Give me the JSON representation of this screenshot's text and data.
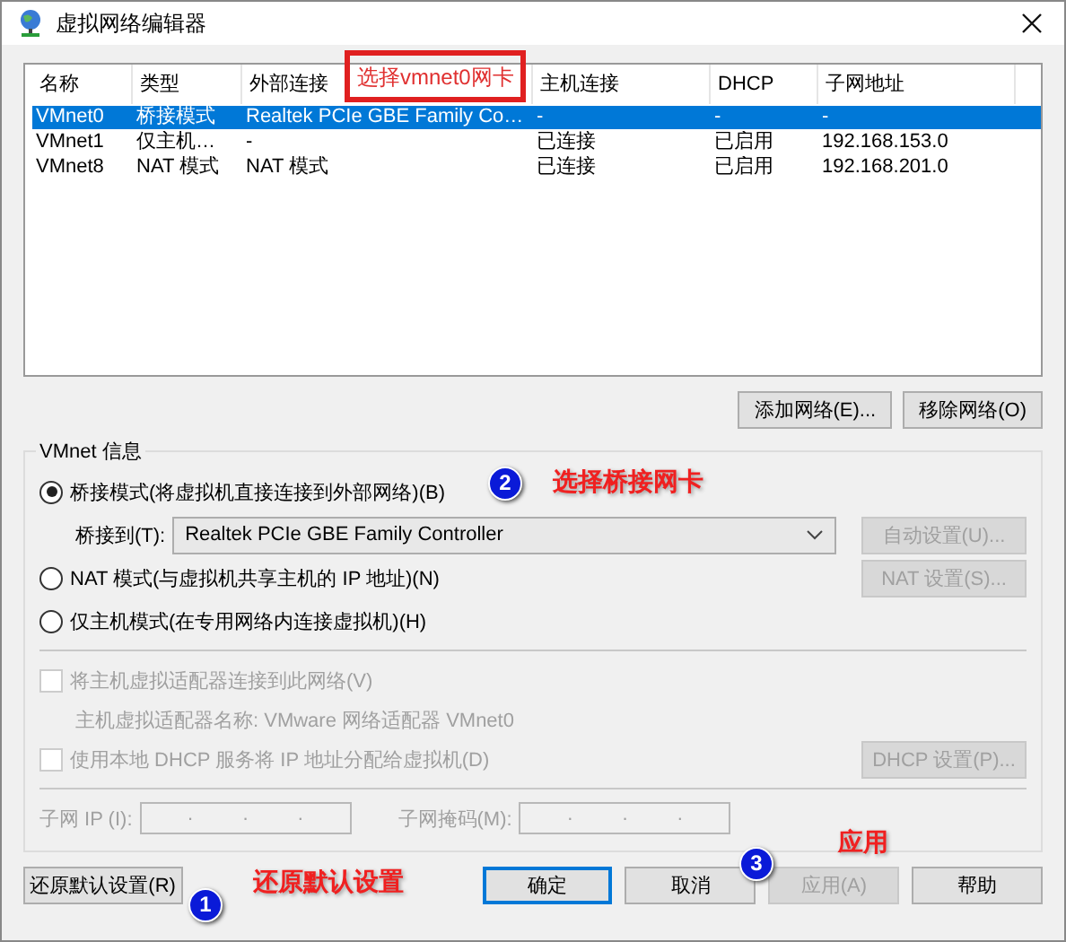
{
  "window": {
    "title": "虚拟网络编辑器"
  },
  "table": {
    "columns": [
      "名称",
      "类型",
      "外部连接",
      "主机连接",
      "DHCP",
      "子网地址"
    ],
    "rows": [
      {
        "cells": [
          "VMnet0",
          "桥接模式",
          "Realtek PCIe GBE Family Co…",
          "-",
          "-",
          "-"
        ],
        "selected": true
      },
      {
        "cells": [
          "VMnet1",
          "仅主机…",
          "-",
          "已连接",
          "已启用",
          "192.168.153.0"
        ],
        "selected": false
      },
      {
        "cells": [
          "VMnet8",
          "NAT 模式",
          "NAT 模式",
          "已连接",
          "已启用",
          "192.168.201.0"
        ],
        "selected": false
      }
    ]
  },
  "table_buttons": [
    {
      "label": "添加网络(E)...",
      "disabled": false
    },
    {
      "label": "移除网络(O)",
      "disabled": false
    }
  ],
  "vmnet_info": {
    "title": "VMnet 信息",
    "modes": [
      {
        "label": "桥接模式(将虚拟机直接连接到外部网络)(B)",
        "selected": true
      },
      {
        "label": "NAT 模式(与虚拟机共享主机的 IP 地址)(N)",
        "selected": false
      },
      {
        "label": "仅主机模式(在专用网络内连接虚拟机)(H)",
        "selected": false
      }
    ],
    "bridge_to": {
      "label": "桥接到(T):",
      "value": "Realtek PCIe GBE Family Controller"
    },
    "auto_button": {
      "label": "自动设置(U)...",
      "disabled": true
    },
    "nat_button": {
      "label": "NAT 设置(S)...",
      "disabled": true
    },
    "host_adapter": {
      "label": "将主机虚拟适配器连接到此网络(V)",
      "checked": false,
      "disabled": true
    },
    "adapter_name": "主机虚拟适配器名称: VMware 网络适配器 VMnet0",
    "dhcp": {
      "label": "使用本地 DHCP 服务将 IP 地址分配给虚拟机(D)",
      "checked": false,
      "disabled": true
    },
    "dhcp_button": {
      "label": "DHCP 设置(P)...",
      "disabled": true
    },
    "subnet_ip": {
      "label": "子网 IP (I):",
      "dots": [
        ".",
        ".",
        "."
      ]
    },
    "subnet_mask": {
      "label": "子网掩码(M):",
      "dots": [
        ".",
        ".",
        "."
      ]
    }
  },
  "buttons": [
    {
      "label": "还原默认设置(R)",
      "disabled": false,
      "default": false
    },
    {
      "label": "确定",
      "disabled": false,
      "default": true
    },
    {
      "label": "取消",
      "disabled": false,
      "default": false
    },
    {
      "label": "应用(A)",
      "disabled": true,
      "default": false
    },
    {
      "label": "帮助",
      "disabled": false,
      "default": false
    }
  ],
  "annotations": [
    {
      "kind": "box",
      "text": "选择vmnet0网卡"
    },
    {
      "kind": "badge",
      "text": "2"
    },
    {
      "kind": "note",
      "text": "选择桥接网卡"
    },
    {
      "kind": "badge",
      "text": "1"
    },
    {
      "kind": "note",
      "text": "还原默认设置"
    },
    {
      "kind": "badge",
      "text": "3"
    },
    {
      "kind": "note",
      "text": "应用"
    }
  ]
}
